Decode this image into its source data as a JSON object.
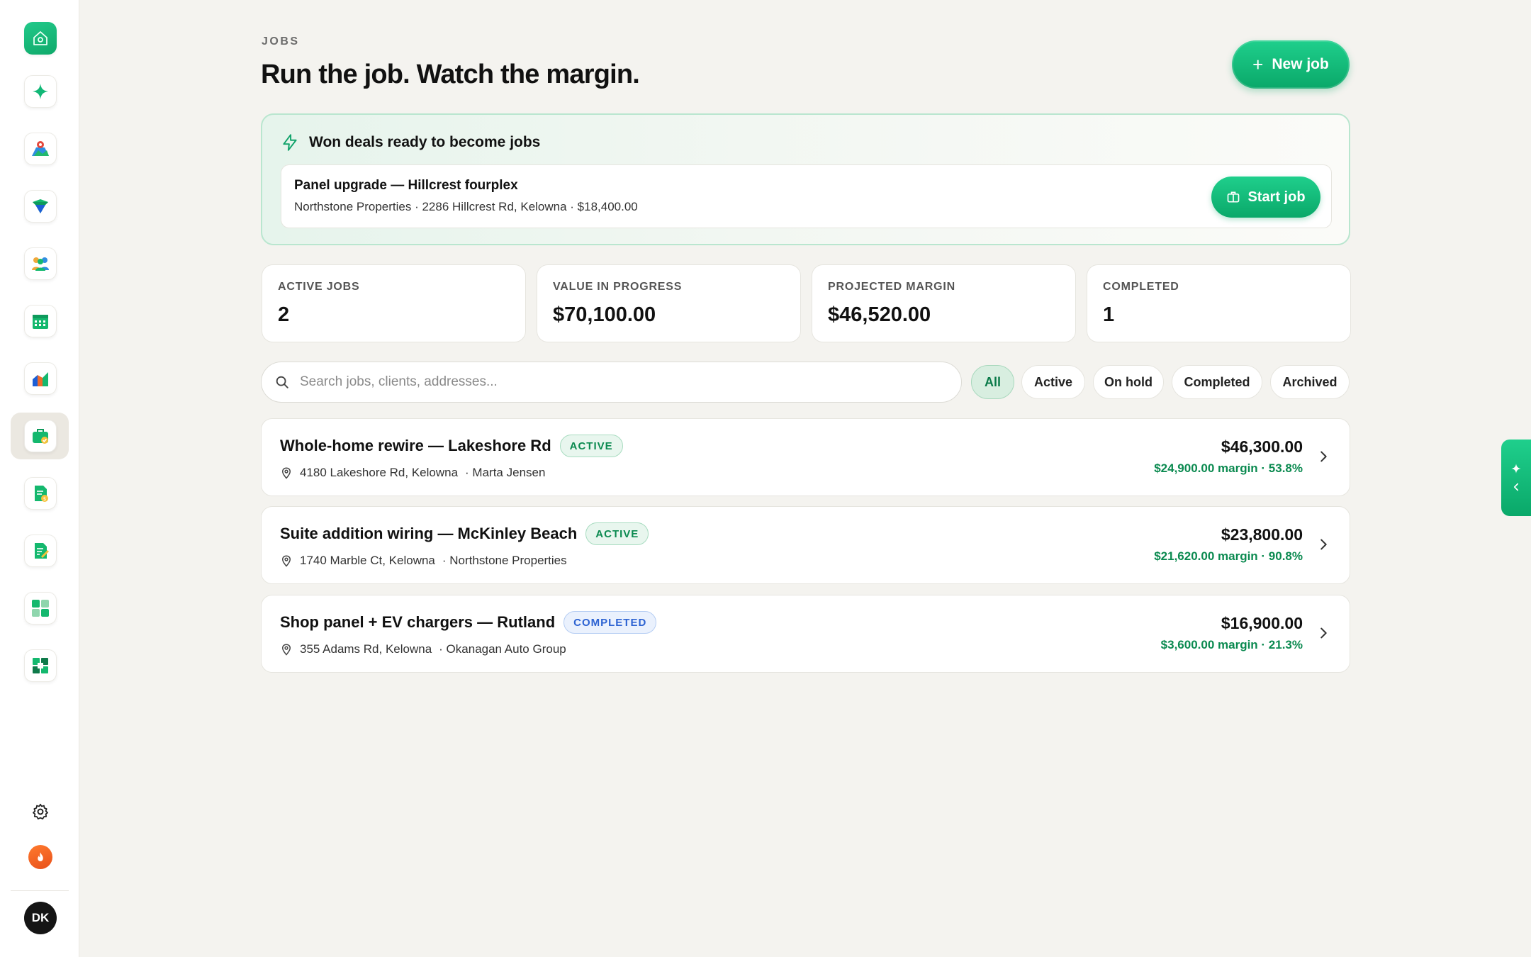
{
  "header": {
    "eyebrow": "JOBS",
    "title": "Run the job. Watch the margin.",
    "new_job_label": "New job"
  },
  "won_deals": {
    "title": "Won deals ready to become jobs",
    "deal": {
      "name": "Panel upgrade — Hillcrest fourplex",
      "meta": "Northstone Properties · 2286 Hillcrest Rd, Kelowna · $18,400.00",
      "action_label": "Start job"
    }
  },
  "stats": [
    {
      "label": "ACTIVE JOBS",
      "value": "2"
    },
    {
      "label": "VALUE IN PROGRESS",
      "value": "$70,100.00"
    },
    {
      "label": "PROJECTED MARGIN",
      "value": "$46,520.00"
    },
    {
      "label": "COMPLETED",
      "value": "1"
    }
  ],
  "search": {
    "placeholder": "Search jobs, clients, addresses...",
    "value": ""
  },
  "filters": {
    "selected": "All",
    "options": [
      "All",
      "Active",
      "On hold",
      "Completed",
      "Archived"
    ]
  },
  "jobs": [
    {
      "title": "Whole-home rewire — Lakeshore Rd",
      "status": "ACTIVE",
      "address": "4180 Lakeshore Rd, Kelowna",
      "client": "· Marta Jensen",
      "amount": "$46,300.00",
      "margin": "$24,900.00 margin · 53.8%"
    },
    {
      "title": "Suite addition wiring — McKinley Beach",
      "status": "ACTIVE",
      "address": "1740 Marble Ct, Kelowna",
      "client": "· Northstone Properties",
      "amount": "$23,800.00",
      "margin": "$21,620.00 margin · 90.8%"
    },
    {
      "title": "Shop panel + EV chargers — Rutland",
      "status": "COMPLETED",
      "address": "355 Adams Rd, Kelowna",
      "client": "· Okanagan Auto Group",
      "amount": "$16,900.00",
      "margin": "$3,600.00 margin · 21.3%"
    }
  ],
  "sidebar": {
    "items": [
      {
        "icon": "home-logo-icon"
      },
      {
        "icon": "sparkle-icon"
      },
      {
        "icon": "map-pin-icon"
      },
      {
        "icon": "shield-check-icon"
      },
      {
        "icon": "team-icon"
      },
      {
        "icon": "calendar-icon"
      },
      {
        "icon": "bar-chart-icon"
      },
      {
        "icon": "briefcase-icon",
        "active": true
      },
      {
        "icon": "invoice-icon"
      },
      {
        "icon": "document-edit-icon"
      },
      {
        "icon": "grid-icon"
      },
      {
        "icon": "integrations-icon"
      }
    ],
    "settings_icon": "gear-icon",
    "streak_icon": "fire-icon",
    "user_initials": "DK"
  },
  "colors": {
    "brand": "#12b877",
    "background": "#f4f3ef",
    "active_badge": "#0b8a50",
    "completed_badge": "#2d63d2"
  }
}
